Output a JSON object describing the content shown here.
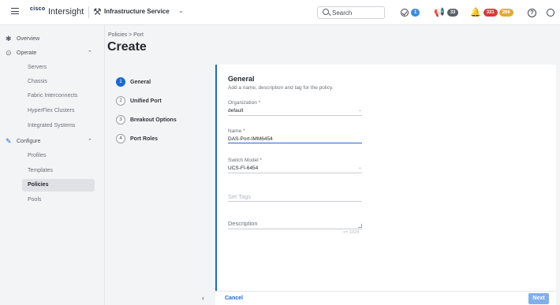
{
  "header": {
    "brand_logo_text": "cisco",
    "brand_name": "Intersight",
    "service_name": "Infrastructure Service",
    "search_placeholder": "Search",
    "tasks_count": "1",
    "notifications_count": "33",
    "alarms_critical": "331",
    "alarms_warning": "266",
    "help_label": "?"
  },
  "sidebar": {
    "overview": "Overview",
    "operate": "Operate",
    "operate_items": [
      "Servers",
      "Chassis",
      "Fabric Interconnects",
      "HyperFlex Clusters",
      "Integrated Systems"
    ],
    "configure": "Configure",
    "configure_items": [
      "Profiles",
      "Templates",
      "Policies",
      "Pools"
    ],
    "active_item": "Policies"
  },
  "page": {
    "breadcrumb": "Policies > Port",
    "title": "Create"
  },
  "steps": [
    {
      "num": "1",
      "name": "General",
      "active": true
    },
    {
      "num": "2",
      "name": "Unified Port",
      "active": false
    },
    {
      "num": "3",
      "name": "Breakout Options",
      "active": false
    },
    {
      "num": "4",
      "name": "Port Roles",
      "active": false
    }
  ],
  "form": {
    "section_title": "General",
    "section_subtitle": "Add a name, description and tag for the policy.",
    "organization_label": "Organization *",
    "organization_value": "default",
    "name_label": "Name *",
    "name_value": "DAS-Port-IMM6454",
    "switch_model_label": "Switch Model *",
    "switch_model_value": "UCS-FI-6454",
    "tags_placeholder": "Set Tags",
    "description_label": "Description",
    "description_counter": "<= 1024"
  },
  "footer": {
    "cancel_label": "Cancel",
    "next_label": "Next"
  },
  "colors": {
    "accent": "#1d69cc",
    "critical": "#d83a3a",
    "warning": "#e2a93b",
    "info": "#3d8be0"
  }
}
